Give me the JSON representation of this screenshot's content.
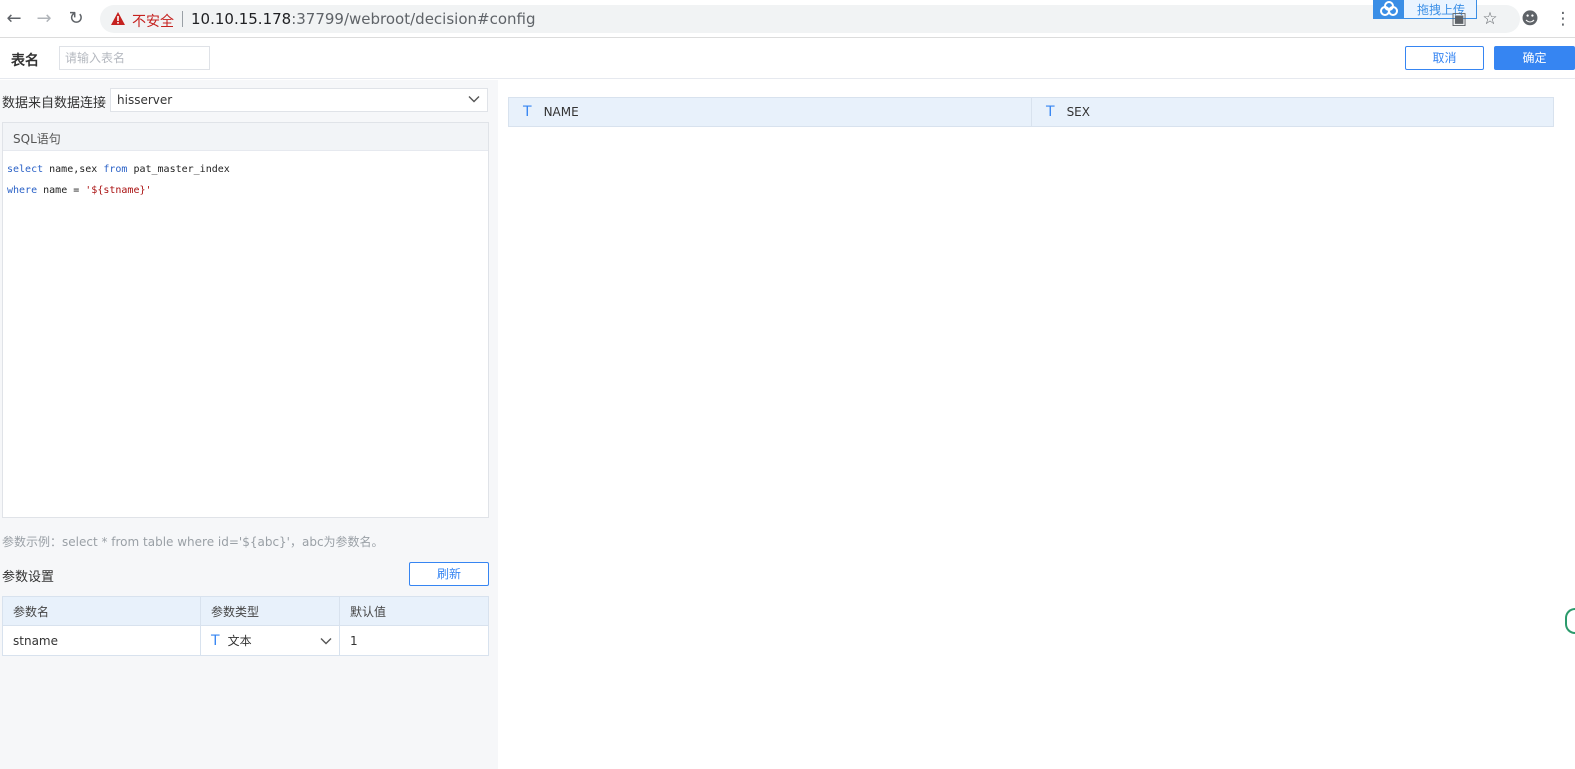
{
  "browser": {
    "insecure_label": "不安全",
    "url_host": "10.10.15.178",
    "url_rest": ":37799/webroot/decision#config",
    "upload_badge": "拖拽上传"
  },
  "header": {
    "table_name_label": "表名",
    "table_name_placeholder": "请输入表名",
    "cancel_label": "取消",
    "confirm_label": "确定"
  },
  "left": {
    "source_label": "数据来自数据连接",
    "source_value": "hisserver",
    "sql_title": "SQL语句",
    "sql_lines": [
      "select name,sex from pat_master_index",
      "where name = '${stname}'"
    ],
    "hint": "参数示例：select * from table where id='${abc}'，abc为参数名。",
    "param_title": "参数设置",
    "refresh_label": "刷新",
    "param_columns": [
      "参数名",
      "参数类型",
      "默认值"
    ],
    "params": [
      {
        "name": "stname",
        "type": "文本",
        "default": "1"
      }
    ]
  },
  "preview": {
    "columns": [
      {
        "type_icon": "T",
        "name": "NAME"
      },
      {
        "type_icon": "T",
        "name": "SEX"
      }
    ]
  }
}
